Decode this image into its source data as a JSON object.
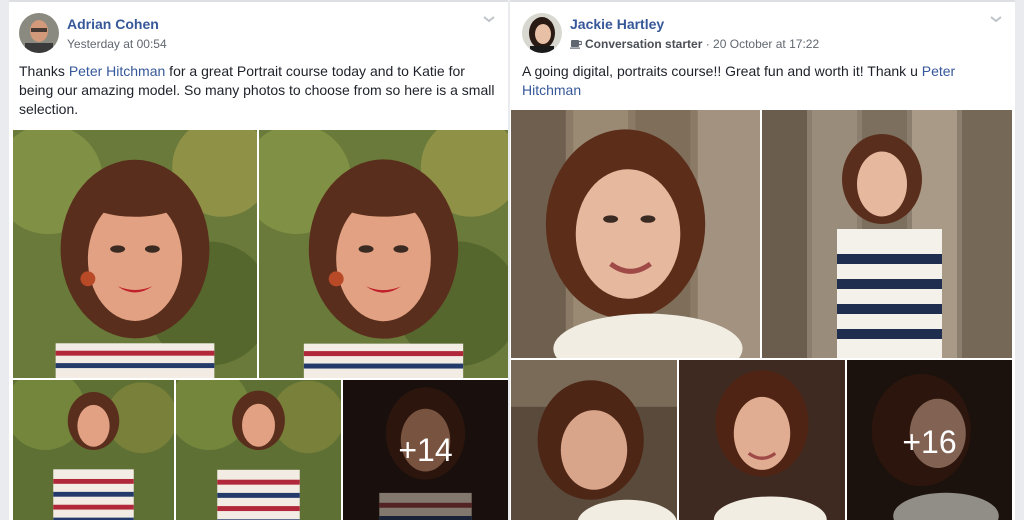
{
  "posts": [
    {
      "author": "Adrian Cohen",
      "timestamp": "Yesterday at 00:54",
      "text_before_link": "Thanks ",
      "link_text": "Peter Hitchman",
      "text_after_link": " for a great Portrait course today and to Katie for being our amazing model. So many photos to choose from so here is a small selection.",
      "more_photos": "+14"
    },
    {
      "author": "Jackie Hartley",
      "activity": "Conversation starter",
      "separator": " · ",
      "timestamp": "20 October at 17:22",
      "text_before_link": "A going digital, portraits course!! Great fun and worth it! Thank u ",
      "link_text": "Peter Hitchman",
      "text_after_link": "",
      "more_photos": "+16"
    }
  ],
  "icons": [
    "chevron-down-icon",
    "coffee-icon"
  ],
  "colors": {
    "link": "#365899",
    "background": "#e9ebee",
    "text": "#1d2129",
    "meta": "#616770"
  }
}
